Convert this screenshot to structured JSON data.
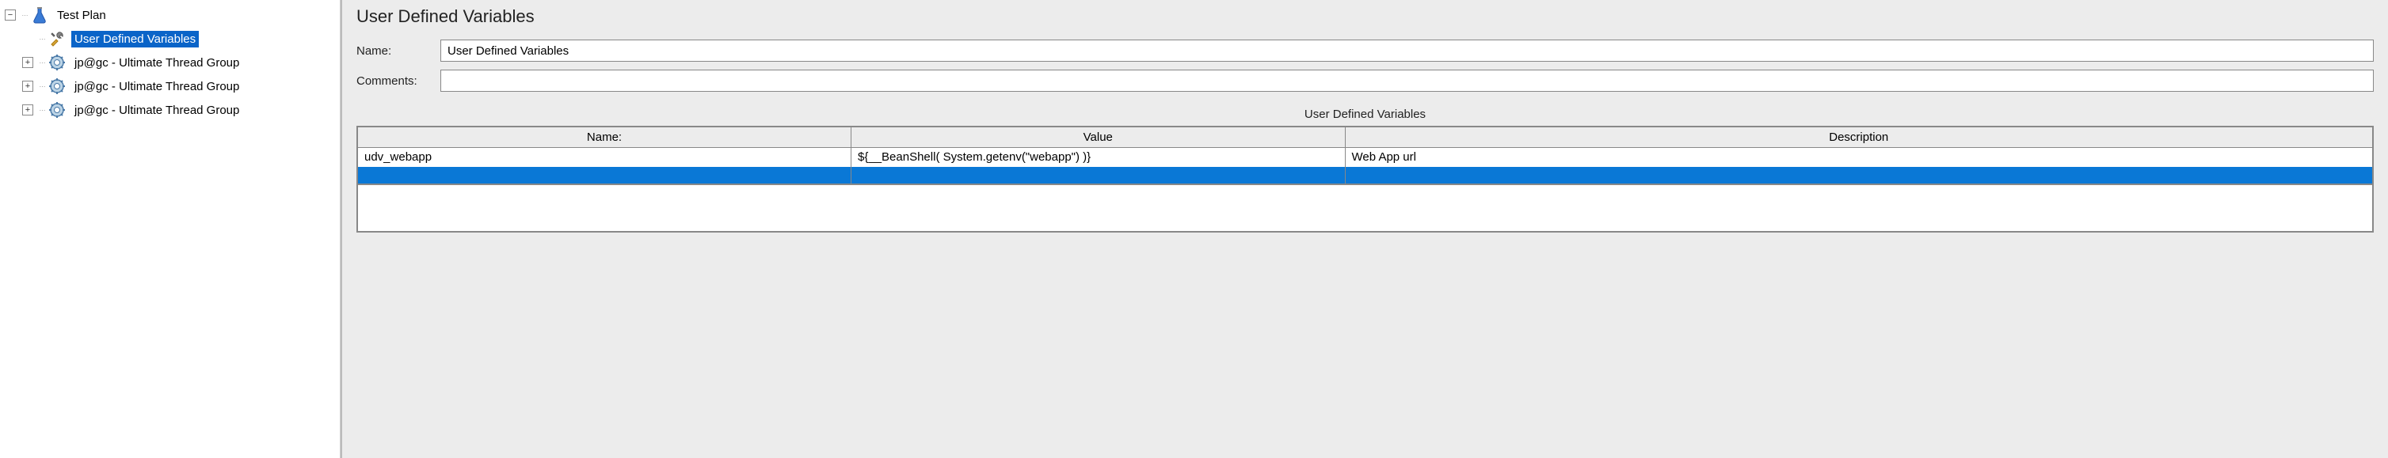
{
  "tree": {
    "root_label": "Test Plan",
    "items": [
      {
        "label": "User Defined Variables",
        "selected": true,
        "icon": "tools"
      },
      {
        "label": "jp@gc - Ultimate Thread Group",
        "selected": false,
        "icon": "gear"
      },
      {
        "label": "jp@gc - Ultimate Thread Group",
        "selected": false,
        "icon": "gear"
      },
      {
        "label": "jp@gc - Ultimate Thread Group",
        "selected": false,
        "icon": "gear"
      }
    ]
  },
  "panel": {
    "title": "User Defined Variables",
    "name_label": "Name:",
    "name_value": "User Defined Variables",
    "comments_label": "Comments:",
    "comments_value": ""
  },
  "table": {
    "section_title": "User Defined Variables",
    "headers": [
      "Name:",
      "Value",
      "Description"
    ],
    "rows": [
      {
        "name": "udv_webapp",
        "value": "${__BeanShell( System.getenv(\"webapp\") )}",
        "description": "Web App url"
      }
    ]
  },
  "icons": {
    "minus": "−",
    "plus": "+"
  }
}
